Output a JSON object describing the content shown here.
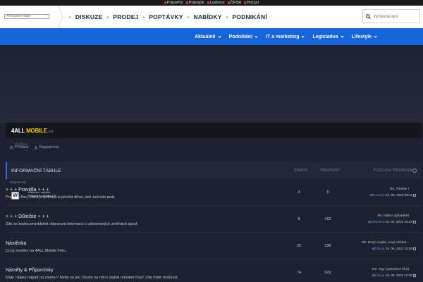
{
  "topbar": {
    "links": [
      "PrácePro",
      "Prácejob",
      "Lustrace",
      "ČRSR",
      "Počasí"
    ],
    "accent": "#c0392b"
  },
  "header": {
    "logo_placeholder": "AntiSpam Bage",
    "nav": [
      "DISKUZE",
      "PRODEJ",
      "POPTÁVKY",
      "NABÍDKY",
      "PODNIKÁNÍ"
    ],
    "search_placeholder": "Vyhledávání",
    "search_icon": "search-icon"
  },
  "bluenav": {
    "color": "#1565d8",
    "items": [
      "Aktuálně",
      "Podnikání",
      "IT a marketing",
      "Legislativa",
      "Lifestyle"
    ]
  },
  "forum": {
    "logo_main": "4ALL ",
    "logo_mobile": "MOBILE",
    "logo_eu": ".eu",
    "login": "Přihlásit",
    "register": "Registrovat",
    "tiny_label": "Přihlásit",
    "register_small": "Registrovat"
  },
  "board": {
    "title": "INFORMAČNÍ TABULE",
    "col_topics": "TÉMATA",
    "col_posts": "PŘÍSPĚVKY",
    "col_last": "POSLEDNÍ PŘÍSPĚVEK",
    "rows": [
      {
        "title": "+ + + Pravidla + + +",
        "desc": "Pravidla fóra, která je potřeba si přečíst dříve, než začnete psát.",
        "topics": "4",
        "posts": "9",
        "last_subject": "Re: Thanks !",
        "last_by": "od",
        "last_user": "Henry1",
        "last_date": "21. 05. 2019 09:11"
      },
      {
        "title": "+ + + Důležité + + +",
        "desc": "Zde se budou pravidelně objevovat informace o plánovaných změnách apod.",
        "topics": "8",
        "posts": "163",
        "last_subject": "Re: Nábor uploaderů",
        "last_by": "od",
        "last_user": "delphino",
        "last_date": "10. 03. 2022 20:23"
      },
      {
        "title": "Nástěnka",
        "desc": "Co je nového na 4ALL Mobile Fóru.",
        "topics": "25",
        "posts": "236",
        "last_subject": "Re: Nový majitel, nový vzhled...",
        "last_by": "od",
        "last_user": "Škopi",
        "last_date": "19. 09. 2022 10:36"
      },
      {
        "title": "Náměty & Připomínky",
        "desc": "Máte nějaký nápad na změnu? Nebo se jen chcete na něco zeptat ohledně fóra? Zde máte možnost.",
        "topics": "74",
        "posts": "929",
        "last_subject": "Re: Tipy (vylepšení fóra)",
        "last_by": "od",
        "last_user": "Škopi",
        "last_date": "19. 09. 2022 10:36"
      }
    ]
  },
  "popup": {
    "letter": "W",
    "line1": "Webowe, největší",
    "line2": "Fotbalové aplikace ČR"
  }
}
